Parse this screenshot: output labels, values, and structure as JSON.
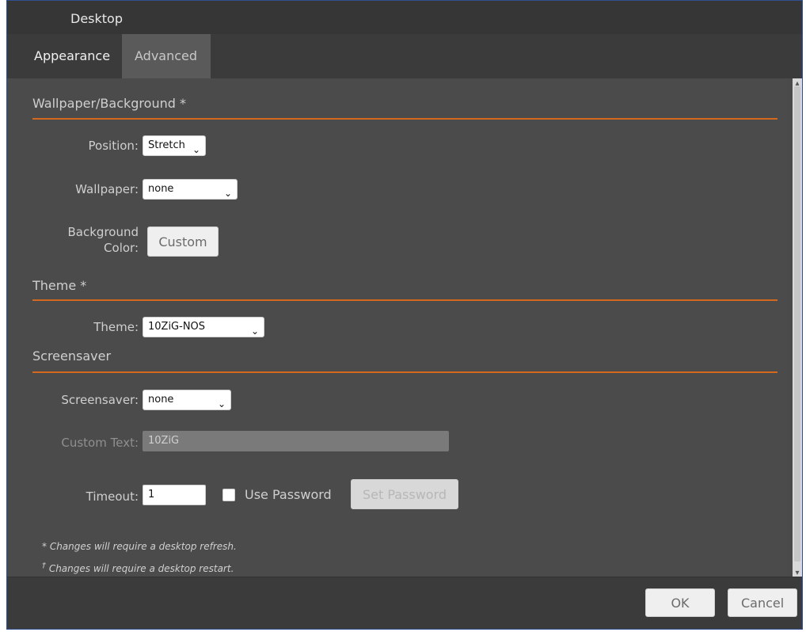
{
  "window": {
    "title": "Desktop"
  },
  "tabs": [
    {
      "label": "Appearance",
      "active": true
    },
    {
      "label": "Advanced",
      "active": false
    }
  ],
  "sections": {
    "wallpaper": {
      "title": "Wallpaper/Background *",
      "position_label": "Position:",
      "position_value": "Stretch",
      "wallpaper_label": "Wallpaper:",
      "wallpaper_value": "none",
      "background_label_line1": "Background",
      "background_label_line2": "Color:",
      "custom_button": "Custom"
    },
    "theme": {
      "title": "Theme *",
      "theme_label": "Theme:",
      "theme_value": "10ZiG-NOS"
    },
    "screensaver": {
      "title": "Screensaver",
      "screensaver_label": "Screensaver:",
      "screensaver_value": "none",
      "custom_text_label": "Custom Text:",
      "custom_text_value": "10ZiG",
      "timeout_label": "Timeout:",
      "timeout_value": "1",
      "use_password_label": "Use Password",
      "set_password_button": "Set Password"
    }
  },
  "notes": {
    "refresh": "* Changes will require a desktop refresh.",
    "restart_marker": "†",
    "restart": " Changes will require a desktop restart."
  },
  "footer": {
    "ok": "OK",
    "cancel": "Cancel"
  },
  "colors": {
    "accent_line": "#d2691e",
    "bg": "#4b4b4b",
    "titlebar": "#363636",
    "footer": "#3b3b3b"
  },
  "icons": {
    "chevron": "chevron-down-icon",
    "scroll_up": "scroll-up-icon",
    "scroll_down": "scroll-down-icon"
  }
}
